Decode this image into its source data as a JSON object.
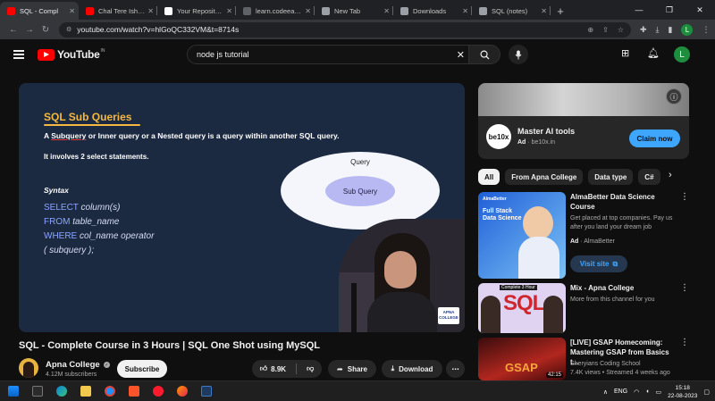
{
  "browser": {
    "tabs": [
      {
        "title": "SQL - Compl",
        "favicon_color": "#ff0000",
        "active": true
      },
      {
        "title": "Chal Tere Ishq Me",
        "favicon_color": "#ff0000",
        "active": false
      },
      {
        "title": "Your Repositories",
        "favicon_color": "#ffffff",
        "active": false
      },
      {
        "title": "learn.codeeasy.io",
        "favicon_color": "#5f6368",
        "active": false
      },
      {
        "title": "New Tab",
        "favicon_color": "#9aa0a6",
        "active": false
      },
      {
        "title": "Downloads",
        "favicon_color": "#9aa0a6",
        "active": false
      },
      {
        "title": "SQL (notes)",
        "favicon_color": "#9aa0a6",
        "active": false
      }
    ],
    "url": "youtube.com/watch?v=hlGoQC332VM&t=8714s",
    "profile_initial": "L"
  },
  "youtube": {
    "logo_text": "YouTube",
    "logo_country": "IN",
    "search_query": "node js tutorial",
    "user_initial": "L"
  },
  "slide": {
    "title": "SQL Sub Queries",
    "definition_prefix": "A ",
    "definition_word": "Subquery",
    "definition_suffix": " or Inner query or a Nested query is a query within another SQL query.",
    "involves": "It involves 2 select statements.",
    "syntax_label": "Syntax",
    "code": [
      {
        "kw": "SELECT",
        "rest": "column(s)"
      },
      {
        "kw": "FROM",
        "rest": "table_name"
      },
      {
        "kw": "WHERE",
        "rest": "col_name operator"
      },
      {
        "kw": "",
        "rest": "( subquery );"
      }
    ],
    "outer_label": "Query",
    "inner_label": "Sub Query",
    "watermark": "APNA COLLEGE"
  },
  "video": {
    "title": "SQL - Complete Course in 3 Hours | SQL One Shot using MySQL",
    "channel": "Apna College",
    "subscribers": "4.12M subscribers",
    "subscribe_label": "Subscribe",
    "likes": "8.9K",
    "share_label": "Share",
    "download_label": "Download"
  },
  "ad": {
    "logo": "be10x",
    "title": "Master AI tools",
    "ad_label": "Ad",
    "domain": "be10x.in",
    "cta": "Claim now"
  },
  "chips": [
    "All",
    "From Apna College",
    "Data type",
    "C#"
  ],
  "recommendations": [
    {
      "title": "AlmaBetter Data Science Course",
      "desc": "Get placed at top companies. Pay us after you land your dream job",
      "ad_label": "Ad",
      "advertiser": "AlmaBetter",
      "cta": "Visit site",
      "thumb_brand": "AlmaBetter",
      "thumb_heading": "Full Stack Data Science"
    },
    {
      "title": "Mix - Apna College",
      "desc": "More from this channel for you",
      "thumb_top": "Complete 3 Hour",
      "thumb_big": "SQL"
    },
    {
      "title": "[LIVE] GSAP Homecoming: Mastering GSAP from Basics t...",
      "channel": "Sheryians Coding School",
      "stats": "7.4K views • Streamed 4 weeks ago",
      "thumb_text": "GSAP",
      "duration": "42:15"
    }
  ],
  "taskbar": {
    "lang": "ENG",
    "time": "15:18",
    "date": "22-08-2023"
  }
}
